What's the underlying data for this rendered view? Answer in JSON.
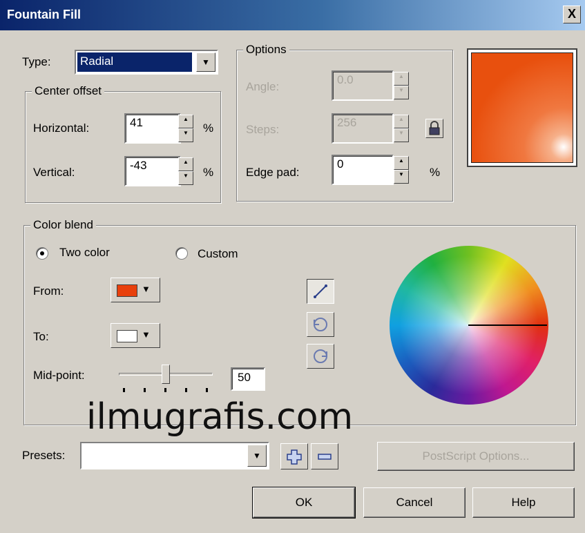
{
  "window": {
    "title": "Fountain Fill",
    "close_glyph": "X"
  },
  "type": {
    "label": "Type:",
    "value": "Radial"
  },
  "center_offset": {
    "title": "Center offset",
    "horizontal_label": "Horizontal:",
    "horizontal_value": "41",
    "horizontal_unit": "%",
    "vertical_label": "Vertical:",
    "vertical_value": "-43",
    "vertical_unit": "%"
  },
  "options": {
    "title": "Options",
    "angle_label": "Angle:",
    "angle_value": "0.0",
    "steps_label": "Steps:",
    "steps_value": "256",
    "edge_pad_label": "Edge pad:",
    "edge_pad_value": "0",
    "edge_pad_unit": "%"
  },
  "preview": {
    "from_color": "#e84a10",
    "to_color": "#ffffff"
  },
  "color_blend": {
    "title": "Color blend",
    "two_color_label": "Two color",
    "custom_label": "Custom",
    "mode_selected": "Two color",
    "from_label": "From:",
    "from_color": "#e8400c",
    "to_label": "To:",
    "to_color": "#ffffff",
    "midpoint_label": "Mid-point:",
    "midpoint_value": "50",
    "blend_icons": [
      "direct-line-icon",
      "counterclockwise-icon",
      "clockwise-icon"
    ]
  },
  "watermark": "ilmugrafis.com",
  "presets": {
    "label": "Presets:",
    "value": "",
    "postscript_label": "PostScript Options..."
  },
  "buttons": {
    "ok": "OK",
    "cancel": "Cancel",
    "help": "Help"
  }
}
